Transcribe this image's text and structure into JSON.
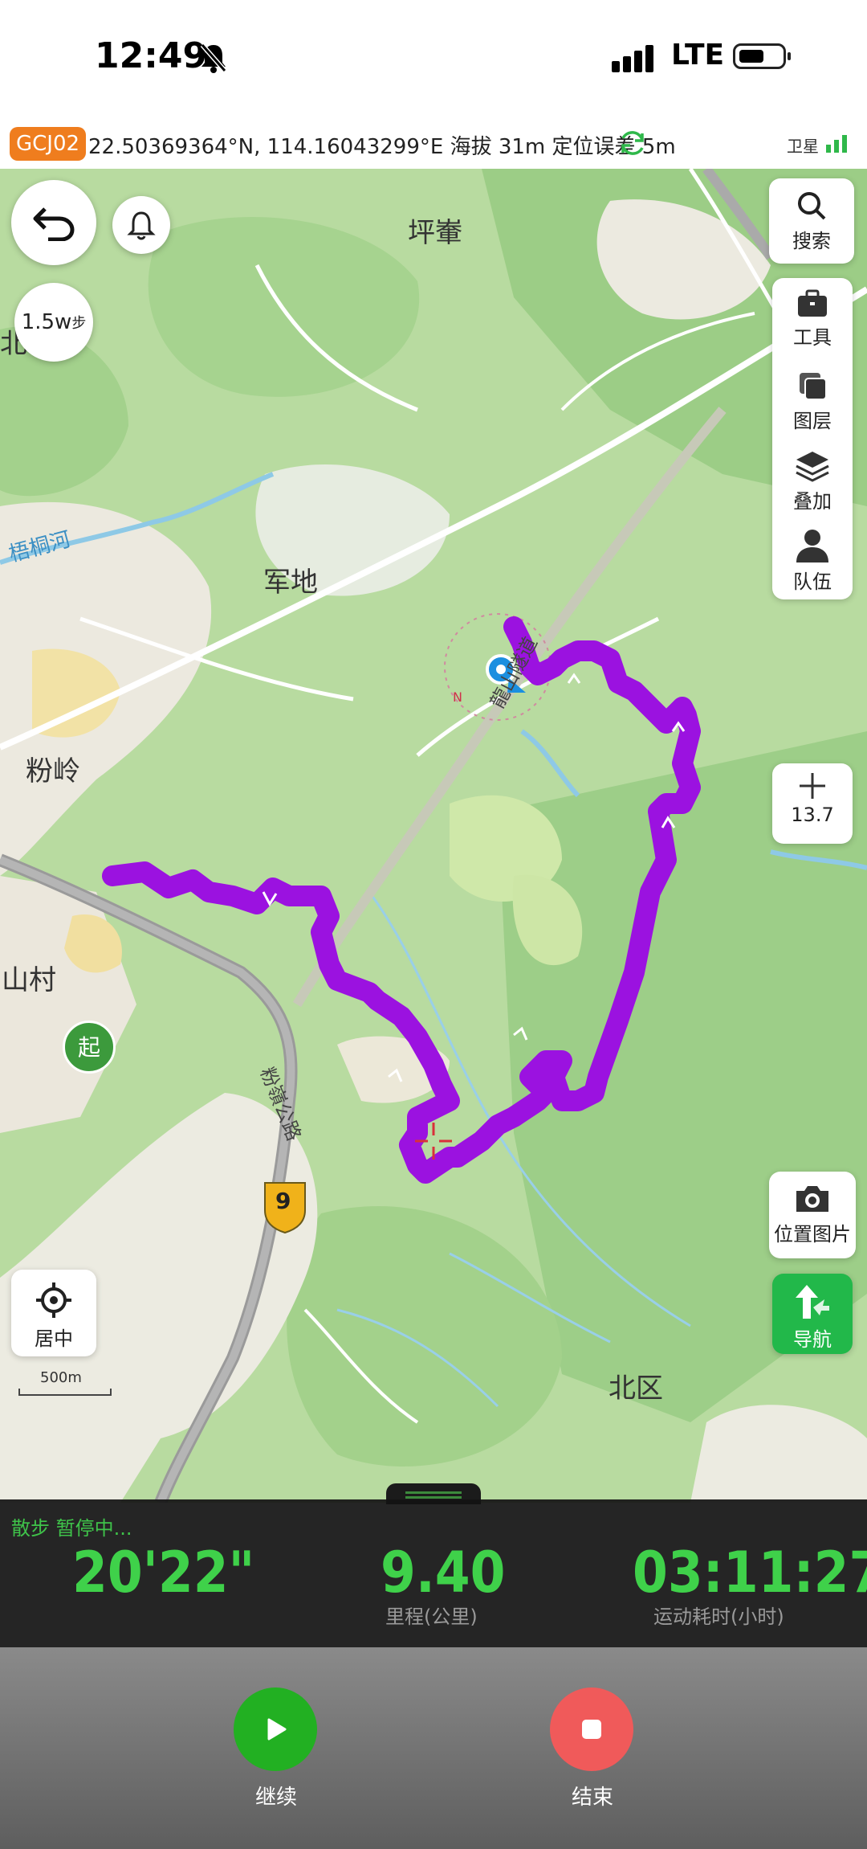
{
  "status_bar": {
    "time": "12:49",
    "network": "LTE"
  },
  "info_bar": {
    "coord_system": "GCJ02",
    "coordinates": "22.50369364°N, 114.16043299°E 海拔 31m  定位误差 5m",
    "satellite_label": "卫星"
  },
  "map": {
    "steps_badge": "1.5w",
    "steps_unit": "步",
    "place_labels": {
      "pinghui": "坪輋",
      "jundi": "军地",
      "fanling": "粉岭",
      "shancun": "山村",
      "beiqu": "北区",
      "bei_edge": "北",
      "river": "梧桐河",
      "tunnel": "龍山隧道",
      "road": "粉嶺公路"
    },
    "route_badge": "9",
    "start_marker": "起",
    "compass_n": "N",
    "scale": "500m",
    "zoom_level": "13.7",
    "route_color": "#9b12e0"
  },
  "tools": {
    "search": "搜索",
    "tools": "工具",
    "layers": "图层",
    "overlay": "叠加",
    "team": "队伍",
    "location_photo": "位置图片",
    "navigate": "导航",
    "center": "居中"
  },
  "stats": {
    "activity": "散步  暂停中...",
    "pace_value": "20'22\"",
    "distance_value": "9.40",
    "distance_caption": "里程(公里)",
    "duration_value": "03:11:27",
    "duration_caption": "运动耗时(小时)"
  },
  "controls": {
    "resume": "继续",
    "stop": "结束"
  }
}
